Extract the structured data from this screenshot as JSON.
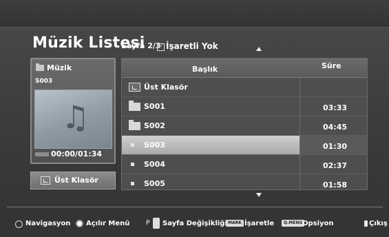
{
  "header": {
    "title": "Müzik Listesi",
    "page_info": "Sayfa 2/3",
    "mark_status": "İşaretli Yok"
  },
  "info_panel": {
    "folder_label": "Müzik",
    "file_name": "S003",
    "time": "00:00/01:34",
    "progress": 0.0
  },
  "up_folder_button": "Üst Klasör",
  "list": {
    "columns": {
      "title": "Başlık",
      "duration": "Süre"
    },
    "rows": [
      {
        "type": "up",
        "name": "Üst Klasör",
        "duration": ""
      },
      {
        "type": "folder",
        "name": "S001",
        "duration": "03:33"
      },
      {
        "type": "folder",
        "name": "S002",
        "duration": "04:45"
      },
      {
        "type": "file",
        "name": "S003",
        "duration": "01:30",
        "selected": true
      },
      {
        "type": "file",
        "name": "S004",
        "duration": "02:37"
      },
      {
        "type": "file",
        "name": "S005",
        "duration": "01:58"
      }
    ]
  },
  "help_bar": {
    "navigate": "Navigasyon",
    "popup": "Açılır Menü",
    "page_change_prefix": "P",
    "page_change": "Sayfa Değişikliği",
    "mark_badge": "MARK",
    "mark": "İşaretle",
    "option_badge": "Q.MENU",
    "option": "Opsiyon",
    "exit": "Çıkış"
  }
}
